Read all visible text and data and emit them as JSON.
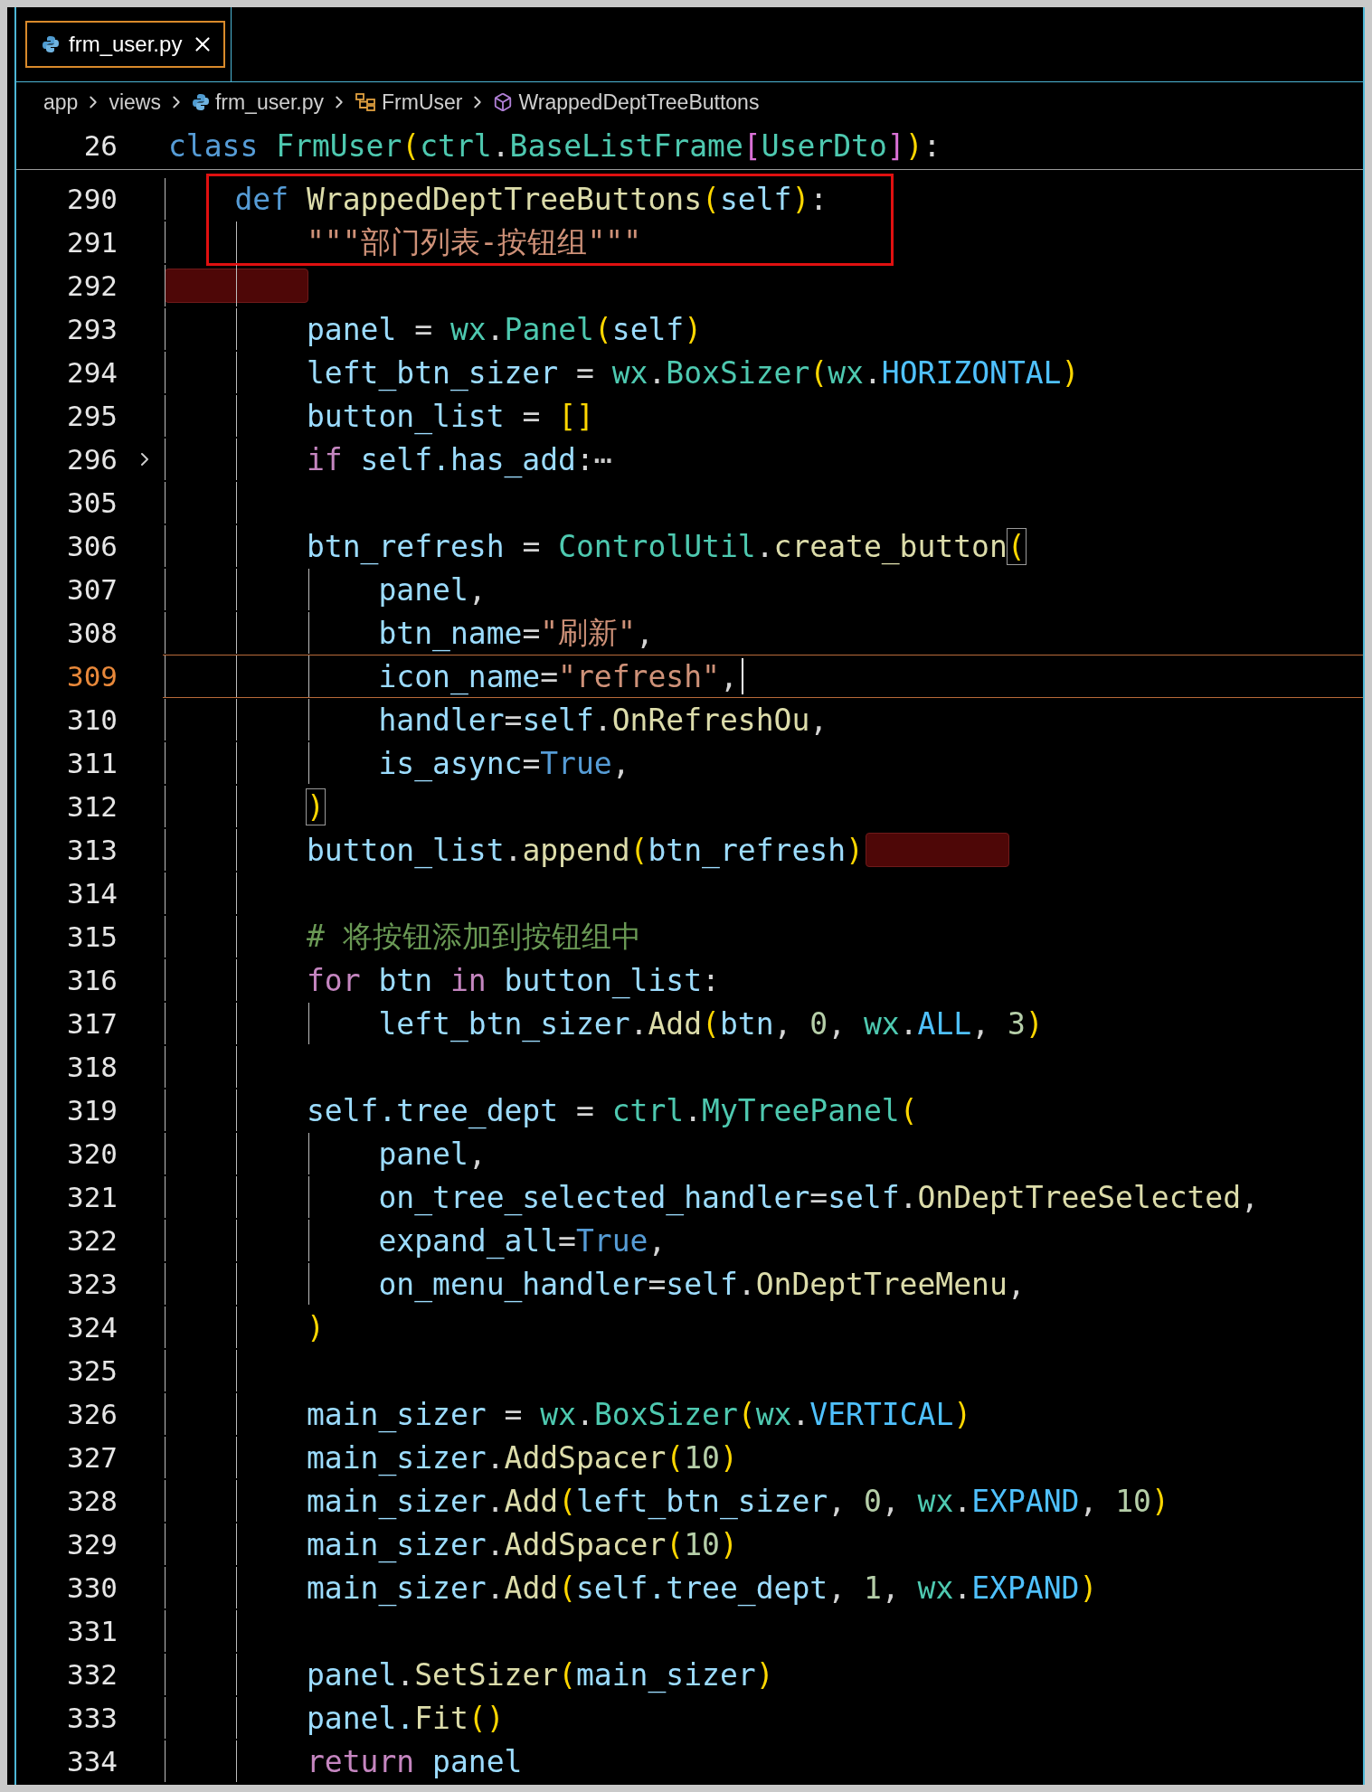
{
  "tab": {
    "label": "frm_user.py",
    "selected": true
  },
  "breadcrumb": [
    {
      "label": "app",
      "kind": "folder"
    },
    {
      "label": "views",
      "kind": "folder"
    },
    {
      "label": "frm_user.py",
      "kind": "file"
    },
    {
      "label": "FrmUser",
      "kind": "class"
    },
    {
      "label": "WrappedDeptTreeButtons",
      "kind": "method"
    }
  ],
  "sticky_line": {
    "number": "26",
    "tokens": [
      {
        "text": "class ",
        "kind": "kw"
      },
      {
        "text": "FrmUser",
        "kind": "cls"
      },
      {
        "text": "(",
        "kind": "b1"
      },
      {
        "text": "ctrl",
        "kind": "cls"
      },
      {
        "text": ".",
        "kind": "op"
      },
      {
        "text": "BaseListFrame",
        "kind": "cls"
      },
      {
        "text": "[",
        "kind": "b2"
      },
      {
        "text": "UserDto",
        "kind": "cls"
      },
      {
        "text": "]",
        "kind": "b2"
      },
      {
        "text": ")",
        "kind": "b1"
      },
      {
        "text": ":",
        "kind": "op"
      }
    ]
  },
  "lines": [
    {
      "number": "290",
      "current": false,
      "folded": false,
      "marked": false,
      "boxed": true,
      "tokens": [
        {
          "text": "    def ",
          "kind": "kw"
        },
        {
          "text": "WrappedDeptTreeButtons",
          "kind": "fn"
        },
        {
          "text": "(",
          "kind": "b1"
        },
        {
          "text": "self",
          "kind": "var"
        },
        {
          "text": ")",
          "kind": "b1"
        },
        {
          "text": ":",
          "kind": "op"
        }
      ]
    },
    {
      "number": "291",
      "current": false,
      "folded": false,
      "marked": false,
      "boxed": true,
      "tokens": [
        {
          "text": "        \"\"\"部门列表-按钮组\"\"\"",
          "kind": "str"
        }
      ]
    },
    {
      "number": "292",
      "current": false,
      "folded": false,
      "marked": true,
      "boxed": false
    },
    {
      "number": "293",
      "current": false,
      "folded": false,
      "marked": false,
      "boxed": false,
      "tokens": [
        {
          "text": "        panel",
          "kind": "var"
        },
        {
          "text": " = ",
          "kind": "op"
        },
        {
          "text": "wx",
          "kind": "cls"
        },
        {
          "text": ".",
          "kind": "op"
        },
        {
          "text": "Panel",
          "kind": "cls"
        },
        {
          "text": "(",
          "kind": "b1"
        },
        {
          "text": "self",
          "kind": "var"
        },
        {
          "text": ")",
          "kind": "b1"
        }
      ]
    },
    {
      "number": "294",
      "current": false,
      "folded": false,
      "marked": false,
      "boxed": false,
      "tokens": [
        {
          "text": "        left_btn_sizer",
          "kind": "var"
        },
        {
          "text": " = ",
          "kind": "op"
        },
        {
          "text": "wx",
          "kind": "cls"
        },
        {
          "text": ".",
          "kind": "op"
        },
        {
          "text": "BoxSizer",
          "kind": "cls"
        },
        {
          "text": "(",
          "kind": "b1"
        },
        {
          "text": "wx",
          "kind": "cls"
        },
        {
          "text": ".",
          "kind": "op"
        },
        {
          "text": "HORIZONTAL",
          "kind": "const"
        },
        {
          "text": ")",
          "kind": "b1"
        }
      ]
    },
    {
      "number": "295",
      "current": false,
      "folded": false,
      "marked": false,
      "boxed": false,
      "tokens": [
        {
          "text": "        button_list",
          "kind": "var"
        },
        {
          "text": " = ",
          "kind": "op"
        },
        {
          "text": "[]",
          "kind": "b1"
        }
      ]
    },
    {
      "number": "296",
      "current": false,
      "folded": true,
      "marked": false,
      "boxed": false,
      "tokens": [
        {
          "text": "        if ",
          "kind": "ctl"
        },
        {
          "text": "self.has_add",
          "kind": "var"
        },
        {
          "text": ":",
          "kind": "op"
        },
        {
          "text": "⋯",
          "kind": "fold"
        }
      ]
    },
    {
      "number": "305",
      "current": false,
      "folded": false,
      "marked": false,
      "boxed": false
    },
    {
      "number": "306",
      "current": false,
      "folded": false,
      "marked": false,
      "boxed": false,
      "tokens": [
        {
          "text": "        btn_refresh",
          "kind": "var"
        },
        {
          "text": " = ",
          "kind": "op"
        },
        {
          "text": "ControlUtil",
          "kind": "cls"
        },
        {
          "text": ".",
          "kind": "op"
        },
        {
          "text": "create_button",
          "kind": "fn"
        },
        {
          "text": "(",
          "kind": "b1box"
        }
      ]
    },
    {
      "number": "307",
      "current": false,
      "folded": false,
      "marked": false,
      "boxed": false,
      "tokens": [
        {
          "text": "            panel",
          "kind": "var"
        },
        {
          "text": ",",
          "kind": "op"
        }
      ]
    },
    {
      "number": "308",
      "current": false,
      "folded": false,
      "marked": false,
      "boxed": false,
      "tokens": [
        {
          "text": "            btn_name",
          "kind": "var"
        },
        {
          "text": "=",
          "kind": "op"
        },
        {
          "text": "\"刷新\"",
          "kind": "str"
        },
        {
          "text": ",",
          "kind": "op"
        }
      ]
    },
    {
      "number": "309",
      "current": true,
      "folded": false,
      "marked": false,
      "boxed": false,
      "tokens": [
        {
          "text": "            icon_name",
          "kind": "var"
        },
        {
          "text": "=",
          "kind": "op"
        },
        {
          "text": "\"refresh\"",
          "kind": "str"
        },
        {
          "text": ",",
          "kind": "op"
        }
      ]
    },
    {
      "number": "310",
      "current": false,
      "folded": false,
      "marked": false,
      "boxed": false,
      "tokens": [
        {
          "text": "            handler",
          "kind": "var"
        },
        {
          "text": "=",
          "kind": "op"
        },
        {
          "text": "self",
          "kind": "var"
        },
        {
          "text": ".",
          "kind": "op"
        },
        {
          "text": "OnRefreshOu",
          "kind": "fn"
        },
        {
          "text": ",",
          "kind": "op"
        }
      ]
    },
    {
      "number": "311",
      "current": false,
      "folded": false,
      "marked": false,
      "boxed": false,
      "tokens": [
        {
          "text": "            is_async",
          "kind": "var"
        },
        {
          "text": "=",
          "kind": "op"
        },
        {
          "text": "True",
          "kind": "kw"
        },
        {
          "text": ",",
          "kind": "op"
        }
      ]
    },
    {
      "number": "312",
      "current": false,
      "folded": false,
      "marked": false,
      "boxed": false,
      "tokens": [
        {
          "text": "        )",
          "kind": "b1box"
        }
      ]
    },
    {
      "number": "313",
      "current": false,
      "folded": false,
      "marked": true,
      "boxed": false,
      "tokens": [
        {
          "text": "        button_list",
          "kind": "var"
        },
        {
          "text": ".",
          "kind": "op"
        },
        {
          "text": "append",
          "kind": "fn"
        },
        {
          "text": "(",
          "kind": "b1"
        },
        {
          "text": "btn_refresh",
          "kind": "var"
        },
        {
          "text": ")",
          "kind": "b1"
        }
      ]
    },
    {
      "number": "314",
      "current": false,
      "folded": false,
      "marked": false,
      "boxed": false
    },
    {
      "number": "315",
      "current": false,
      "folded": false,
      "marked": false,
      "boxed": false,
      "tokens": [
        {
          "text": "        # 将按钮添加到按钮组中",
          "kind": "cmt"
        }
      ]
    },
    {
      "number": "316",
      "current": false,
      "folded": false,
      "marked": false,
      "boxed": false,
      "tokens": [
        {
          "text": "        for ",
          "kind": "ctl"
        },
        {
          "text": "btn ",
          "kind": "var"
        },
        {
          "text": "in ",
          "kind": "ctl"
        },
        {
          "text": "button_list",
          "kind": "var"
        },
        {
          "text": ":",
          "kind": "op"
        }
      ]
    },
    {
      "number": "317",
      "current": false,
      "folded": false,
      "marked": false,
      "boxed": false,
      "tokens": [
        {
          "text": "            left_btn_sizer",
          "kind": "var"
        },
        {
          "text": ".",
          "kind": "op"
        },
        {
          "text": "Add",
          "kind": "fn"
        },
        {
          "text": "(",
          "kind": "b1"
        },
        {
          "text": "btn",
          "kind": "var"
        },
        {
          "text": ", ",
          "kind": "op"
        },
        {
          "text": "0",
          "kind": "num"
        },
        {
          "text": ", ",
          "kind": "op"
        },
        {
          "text": "wx",
          "kind": "cls"
        },
        {
          "text": ".",
          "kind": "op"
        },
        {
          "text": "ALL",
          "kind": "const"
        },
        {
          "text": ", ",
          "kind": "op"
        },
        {
          "text": "3",
          "kind": "num"
        },
        {
          "text": ")",
          "kind": "b1"
        }
      ]
    },
    {
      "number": "318",
      "current": false,
      "folded": false,
      "marked": false,
      "boxed": false
    },
    {
      "number": "319",
      "current": false,
      "folded": false,
      "marked": false,
      "boxed": false,
      "tokens": [
        {
          "text": "        self.tree_dept",
          "kind": "var"
        },
        {
          "text": " = ",
          "kind": "op"
        },
        {
          "text": "ctrl",
          "kind": "cls"
        },
        {
          "text": ".",
          "kind": "op"
        },
        {
          "text": "MyTreePanel",
          "kind": "cls"
        },
        {
          "text": "(",
          "kind": "b1"
        }
      ]
    },
    {
      "number": "320",
      "current": false,
      "folded": false,
      "marked": false,
      "boxed": false,
      "tokens": [
        {
          "text": "            panel",
          "kind": "var"
        },
        {
          "text": ",",
          "kind": "op"
        }
      ]
    },
    {
      "number": "321",
      "current": false,
      "folded": false,
      "marked": false,
      "boxed": false,
      "tokens": [
        {
          "text": "            on_tree_selected_handler",
          "kind": "var"
        },
        {
          "text": "=",
          "kind": "op"
        },
        {
          "text": "self",
          "kind": "var"
        },
        {
          "text": ".",
          "kind": "op"
        },
        {
          "text": "OnDeptTreeSelected",
          "kind": "fn"
        },
        {
          "text": ",",
          "kind": "op"
        }
      ]
    },
    {
      "number": "322",
      "current": false,
      "folded": false,
      "marked": false,
      "boxed": false,
      "tokens": [
        {
          "text": "            expand_all",
          "kind": "var"
        },
        {
          "text": "=",
          "kind": "op"
        },
        {
          "text": "True",
          "kind": "kw"
        },
        {
          "text": ",",
          "kind": "op"
        }
      ]
    },
    {
      "number": "323",
      "current": false,
      "folded": false,
      "marked": false,
      "boxed": false,
      "tokens": [
        {
          "text": "            on_menu_handler",
          "kind": "var"
        },
        {
          "text": "=",
          "kind": "op"
        },
        {
          "text": "self",
          "kind": "var"
        },
        {
          "text": ".",
          "kind": "op"
        },
        {
          "text": "OnDeptTreeMenu",
          "kind": "fn"
        },
        {
          "text": ",",
          "kind": "op"
        }
      ]
    },
    {
      "number": "324",
      "current": false,
      "folded": false,
      "marked": false,
      "boxed": false,
      "tokens": [
        {
          "text": "        )",
          "kind": "b1"
        }
      ]
    },
    {
      "number": "325",
      "current": false,
      "folded": false,
      "marked": false,
      "boxed": false
    },
    {
      "number": "326",
      "current": false,
      "folded": false,
      "marked": false,
      "boxed": false,
      "tokens": [
        {
          "text": "        main_sizer",
          "kind": "var"
        },
        {
          "text": " = ",
          "kind": "op"
        },
        {
          "text": "wx",
          "kind": "cls"
        },
        {
          "text": ".",
          "kind": "op"
        },
        {
          "text": "BoxSizer",
          "kind": "cls"
        },
        {
          "text": "(",
          "kind": "b1"
        },
        {
          "text": "wx",
          "kind": "cls"
        },
        {
          "text": ".",
          "kind": "op"
        },
        {
          "text": "VERTICAL",
          "kind": "const"
        },
        {
          "text": ")",
          "kind": "b1"
        }
      ]
    },
    {
      "number": "327",
      "current": false,
      "folded": false,
      "marked": false,
      "boxed": false,
      "tokens": [
        {
          "text": "        main_sizer",
          "kind": "var"
        },
        {
          "text": ".",
          "kind": "op"
        },
        {
          "text": "AddSpacer",
          "kind": "fn"
        },
        {
          "text": "(",
          "kind": "b1"
        },
        {
          "text": "10",
          "kind": "num"
        },
        {
          "text": ")",
          "kind": "b1"
        }
      ]
    },
    {
      "number": "328",
      "current": false,
      "folded": false,
      "marked": false,
      "boxed": false,
      "tokens": [
        {
          "text": "        main_sizer",
          "kind": "var"
        },
        {
          "text": ".",
          "kind": "op"
        },
        {
          "text": "Add",
          "kind": "fn"
        },
        {
          "text": "(",
          "kind": "b1"
        },
        {
          "text": "left_btn_sizer",
          "kind": "var"
        },
        {
          "text": ", ",
          "kind": "op"
        },
        {
          "text": "0",
          "kind": "num"
        },
        {
          "text": ", ",
          "kind": "op"
        },
        {
          "text": "wx",
          "kind": "cls"
        },
        {
          "text": ".",
          "kind": "op"
        },
        {
          "text": "EXPAND",
          "kind": "const"
        },
        {
          "text": ", ",
          "kind": "op"
        },
        {
          "text": "10",
          "kind": "num"
        },
        {
          "text": ")",
          "kind": "b1"
        }
      ]
    },
    {
      "number": "329",
      "current": false,
      "folded": false,
      "marked": false,
      "boxed": false,
      "tokens": [
        {
          "text": "        main_sizer",
          "kind": "var"
        },
        {
          "text": ".",
          "kind": "op"
        },
        {
          "text": "AddSpacer",
          "kind": "fn"
        },
        {
          "text": "(",
          "kind": "b1"
        },
        {
          "text": "10",
          "kind": "num"
        },
        {
          "text": ")",
          "kind": "b1"
        }
      ]
    },
    {
      "number": "330",
      "current": false,
      "folded": false,
      "marked": false,
      "boxed": false,
      "tokens": [
        {
          "text": "        main_sizer",
          "kind": "var"
        },
        {
          "text": ".",
          "kind": "op"
        },
        {
          "text": "Add",
          "kind": "fn"
        },
        {
          "text": "(",
          "kind": "b1"
        },
        {
          "text": "self.tree_dept",
          "kind": "var"
        },
        {
          "text": ", ",
          "kind": "op"
        },
        {
          "text": "1",
          "kind": "num"
        },
        {
          "text": ", ",
          "kind": "op"
        },
        {
          "text": "wx",
          "kind": "cls"
        },
        {
          "text": ".",
          "kind": "op"
        },
        {
          "text": "EXPAND",
          "kind": "const"
        },
        {
          "text": ")",
          "kind": "b1"
        }
      ]
    },
    {
      "number": "331",
      "current": false,
      "folded": false,
      "marked": false,
      "boxed": false
    },
    {
      "number": "332",
      "current": false,
      "folded": false,
      "marked": false,
      "boxed": false,
      "tokens": [
        {
          "text": "        panel",
          "kind": "var"
        },
        {
          "text": ".",
          "kind": "op"
        },
        {
          "text": "SetSizer",
          "kind": "fn"
        },
        {
          "text": "(",
          "kind": "b1"
        },
        {
          "text": "main_sizer",
          "kind": "var"
        },
        {
          "text": ")",
          "kind": "b1"
        }
      ]
    },
    {
      "number": "333",
      "current": false,
      "folded": false,
      "marked": false,
      "boxed": false,
      "tokens": [
        {
          "text": "        panel.",
          "kind": "var"
        },
        {
          "text": "Fit",
          "kind": "fn"
        },
        {
          "text": "()",
          "kind": "b1"
        }
      ]
    },
    {
      "number": "334",
      "current": false,
      "folded": false,
      "marked": false,
      "boxed": false,
      "tokens": [
        {
          "text": "        return ",
          "kind": "ctl"
        },
        {
          "text": "panel",
          "kind": "var"
        }
      ]
    }
  ]
}
